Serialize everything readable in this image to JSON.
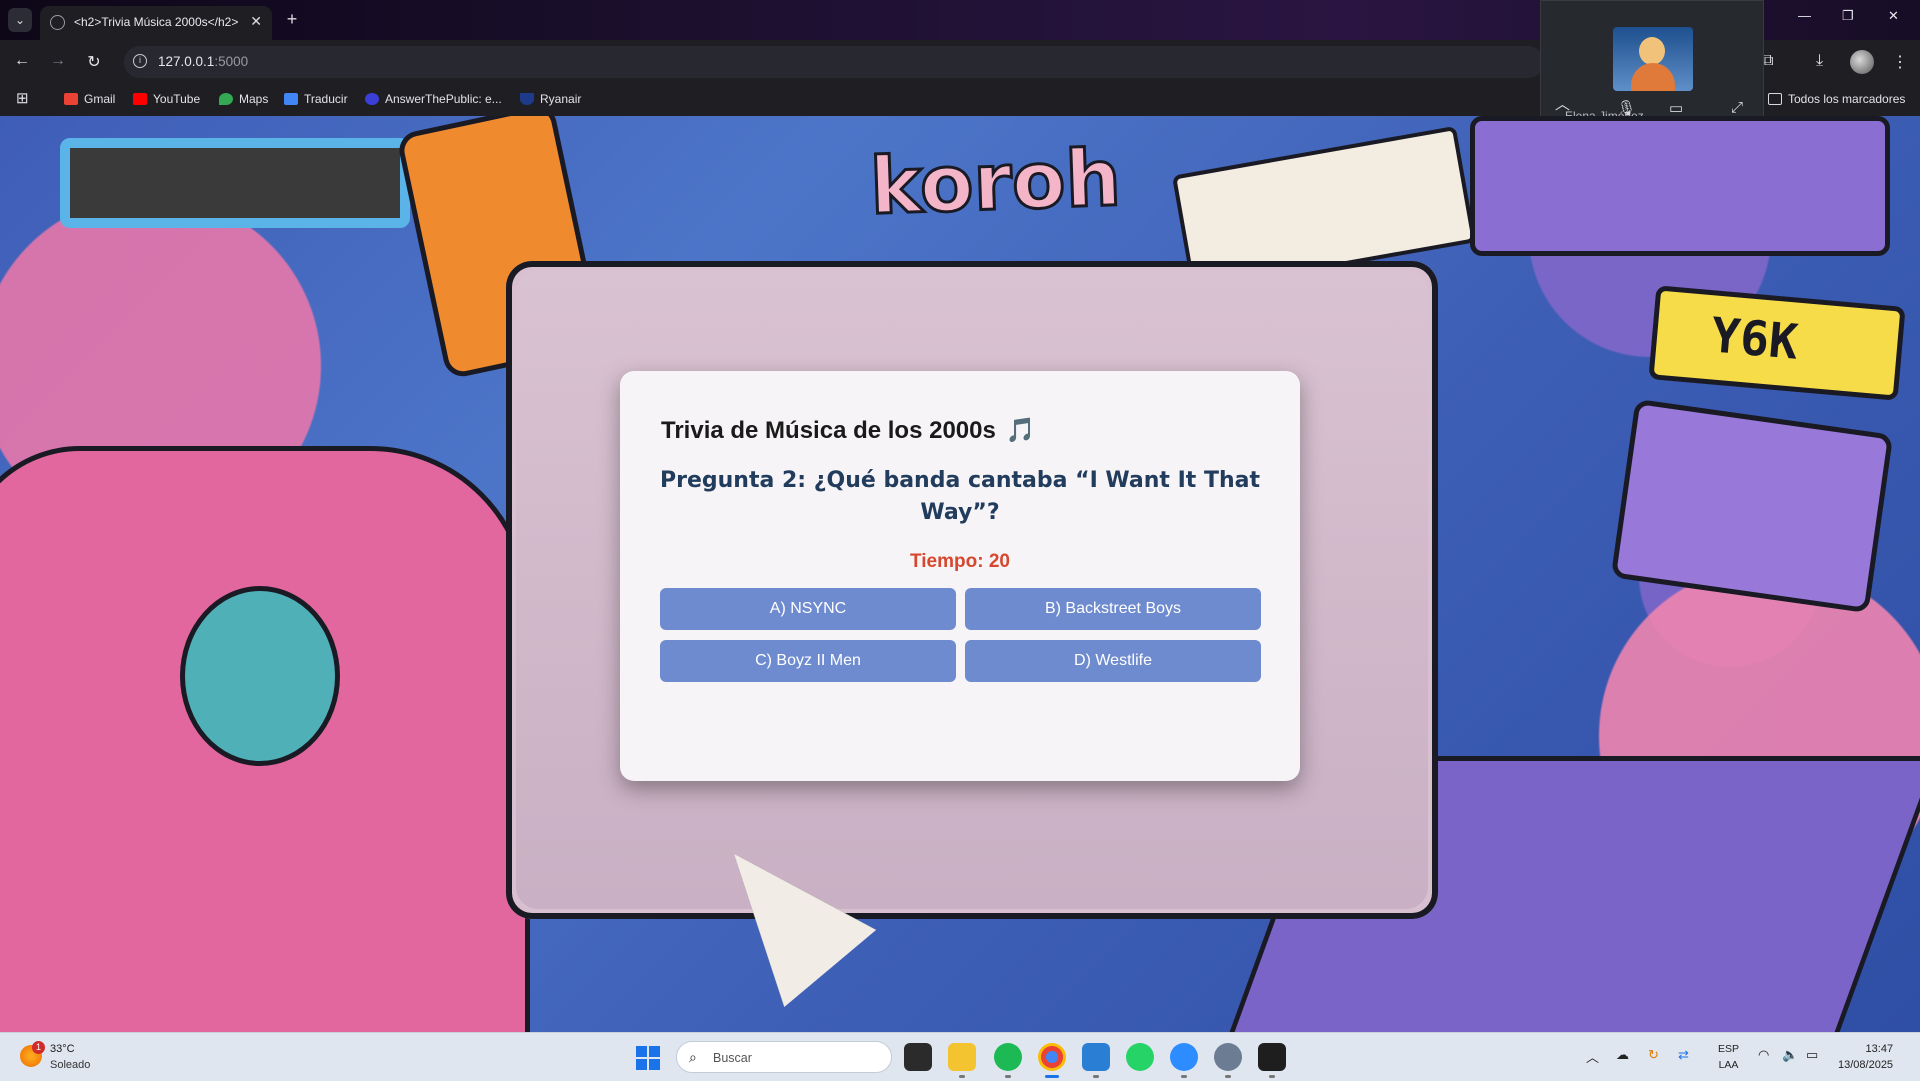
{
  "browser": {
    "tab_title": "<h2>Trivia Música 2000s</h2>",
    "tab_close": "✕",
    "new_tab": "+",
    "tab_list": "⌄",
    "url_host": "127.0.0.1",
    "url_port": ":5000",
    "window_controls": [
      "—",
      "❐",
      "✕"
    ]
  },
  "nav": {
    "back": "←",
    "forward": "→",
    "reload": "↻"
  },
  "bookmarks": {
    "apps_icon": "⊞",
    "items": [
      {
        "label": "Gmail",
        "color": "#ea4335"
      },
      {
        "label": "YouTube",
        "color": "#ff0000"
      },
      {
        "label": "Maps",
        "color": "#34a853"
      },
      {
        "label": "Traducir",
        "color": "#4285f4"
      },
      {
        "label": "AnswerThePublic: e...",
        "color": "#3b3fd8"
      },
      {
        "label": "Ryanair",
        "color": "#1e3a8a"
      }
    ],
    "all_bookmarks": "Todos los marcadores"
  },
  "meet": {
    "participant_name": "Elena Jiménez"
  },
  "background_art": {
    "logo_text": "koroh",
    "tag_text": "Y6K"
  },
  "quiz": {
    "title": "Trivia de Música de los 2000s",
    "title_emoji": "🎵",
    "question": "Pregunta 2: ¿Qué banda cantaba “I Want It That Way”?",
    "timer": "Tiempo: 20",
    "options": [
      "A) NSYNC",
      "B) Backstreet Boys",
      "C) Boyz II Men",
      "D) Westlife"
    ],
    "colors": {
      "option_bg": "#6f8bd0",
      "question": "#213c5c",
      "timer": "#d5482e"
    }
  },
  "taskbar": {
    "weather_temp": "33°C",
    "weather_desc": "Soleado",
    "weather_badge": "1",
    "search_placeholder": "Buscar",
    "lang_line1": "ESP",
    "lang_line2": "LAA",
    "time": "13:47",
    "date": "13/08/2025"
  }
}
